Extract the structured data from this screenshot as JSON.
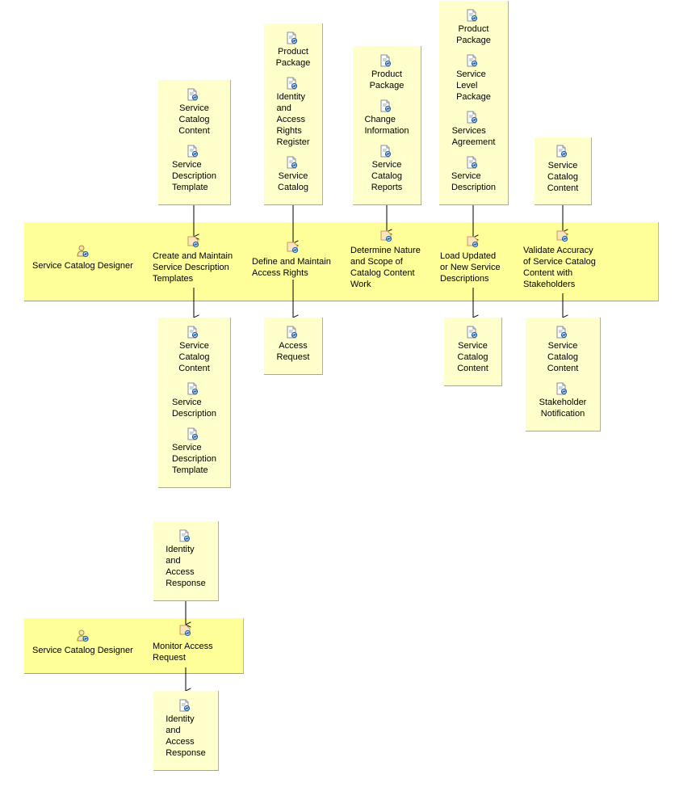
{
  "colors": {
    "lane_fill": "#ffff99",
    "artifact_fill": "#ffffcc",
    "edge": "#000000",
    "icon_blue": "#1b5fa8",
    "icon_orange": "#d9a066"
  },
  "lanes": [
    {
      "role": "Service Catalog Designer",
      "tasks": [
        {
          "label": "Create and Maintain\nService Description\nTemplates",
          "inputs": [
            "Service\nCatalog\nContent",
            "Service\nDescription\nTemplate"
          ],
          "outputs": [
            "Service\nCatalog\nContent",
            "Service\nDescription",
            "Service\nDescription\nTemplate"
          ]
        },
        {
          "label": "Define and Maintain\nAccess Rights",
          "inputs": [
            "Product\nPackage",
            "Identity\nand\nAccess\nRights\nRegister",
            "Service\nCatalog"
          ],
          "outputs": [
            "Access\nRequest"
          ]
        },
        {
          "label": "Determine Nature\nand Scope of\nCatalog Content\nWork",
          "inputs": [
            "Product\nPackage",
            "Change\nInformation",
            "Service\nCatalog\nReports"
          ],
          "outputs": []
        },
        {
          "label": "Load Updated\nor New Service\nDescriptions",
          "inputs": [
            "Product\nPackage",
            "Service\nLevel\nPackage",
            "Services\nAgreement",
            "Service\nDescription"
          ],
          "outputs": [
            "Service\nCatalog\nContent"
          ]
        },
        {
          "label": "Validate Accuracy\nof Service Catalog\nContent with\nStakeholders",
          "inputs": [
            "Service\nCatalog\nContent"
          ],
          "outputs": [
            "Service\nCatalog\nContent",
            "Stakeholder\nNotification"
          ]
        }
      ]
    },
    {
      "role": "Service Catalog Designer",
      "tasks": [
        {
          "label": "Monitor Access\nRequest",
          "inputs": [
            "Identity\nand\nAccess\nResponse"
          ],
          "outputs": [
            "Identity\nand\nAccess\nResponse"
          ]
        }
      ]
    }
  ],
  "icons": {
    "artifact": "work-product-icon",
    "role": "role-icon",
    "task": "task-icon"
  }
}
